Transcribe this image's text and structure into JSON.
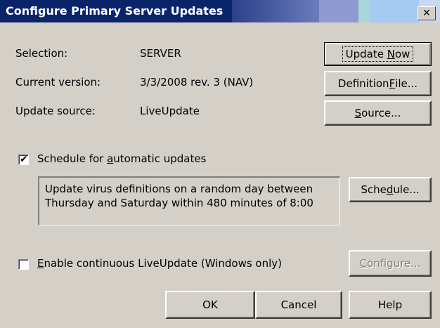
{
  "window": {
    "title": "Configure Primary Server Updates",
    "close_glyph": "✕"
  },
  "info": [
    {
      "label": "Selection:",
      "value": "SERVER"
    },
    {
      "label": "Current version:",
      "value": "3/3/2008 rev. 3 (NAV)"
    },
    {
      "label": "Update source:",
      "value": "LiveUpdate"
    }
  ],
  "buttons": {
    "update_now": {
      "pre": "Update ",
      "mnemonic": "N",
      "post": "ow"
    },
    "definition_file": {
      "pre": "Definition ",
      "mnemonic": "F",
      "post": "ile..."
    },
    "source": {
      "pre": "",
      "mnemonic": "S",
      "post": "ource..."
    },
    "schedule": {
      "pre": "Sche",
      "mnemonic": "d",
      "post": "ule..."
    },
    "configure": {
      "pre": "",
      "mnemonic": "C",
      "post": "onfigure..."
    },
    "ok": "OK",
    "cancel": "Cancel",
    "help": "Help"
  },
  "schedule_checkbox": {
    "pre": "Schedule for ",
    "mnemonic": "a",
    "post": "utomatic updates",
    "checked": true,
    "check_glyph": "✔"
  },
  "schedule_description": {
    "line1": "Update virus definitions on a random day between",
    "line2": "Thursday and Saturday within 480 minutes of 8:00"
  },
  "continuous_checkbox": {
    "pre": "",
    "mnemonic": "E",
    "post": "nable continuous LiveUpdate (Windows only)",
    "checked": false
  }
}
